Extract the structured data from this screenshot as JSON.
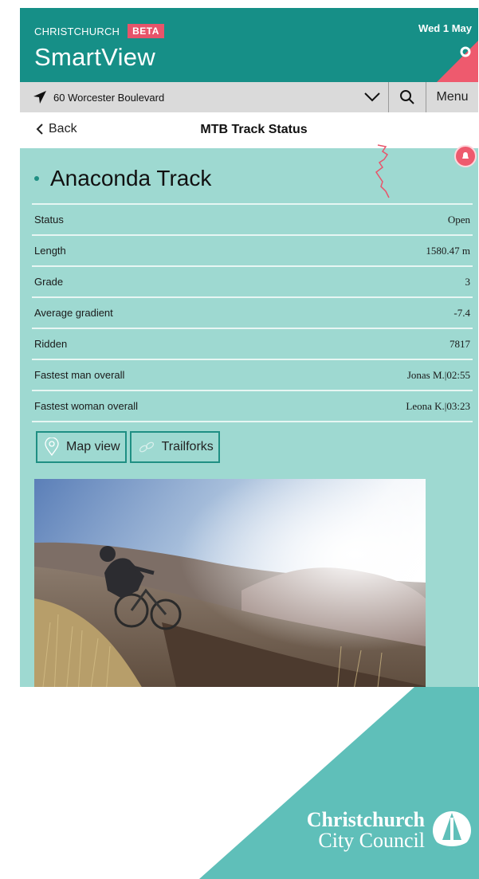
{
  "header": {
    "city": "CHRISTCHURCH",
    "beta": "BETA",
    "app_name": "SmartView",
    "date": "Wed 1 May",
    "brand_color": "#168f87",
    "accent_color": "#ee5a6e"
  },
  "location": {
    "address": "60 Worcester Boulevard",
    "menu_label": "Menu"
  },
  "nav": {
    "back_label": "Back",
    "page_title": "MTB Track Status"
  },
  "track": {
    "name": "Anaconda Track",
    "rows": [
      {
        "label": "Status",
        "value": "Open"
      },
      {
        "label": "Length",
        "value": "1580.47 m"
      },
      {
        "label": "Grade",
        "value": "3"
      },
      {
        "label": "Average gradient",
        "value": "-7.4"
      },
      {
        "label": "Ridden",
        "value": "7817"
      },
      {
        "label": "Fastest man overall",
        "value": "Jonas M.|02:55"
      },
      {
        "label": "Fastest woman overall",
        "value": "Leona K.|03:23"
      }
    ],
    "buttons": {
      "map_view": "Map view",
      "trailforks": "Trailforks"
    }
  },
  "footer": {
    "logo_line1": "Christchurch",
    "logo_line2": "City Council"
  }
}
